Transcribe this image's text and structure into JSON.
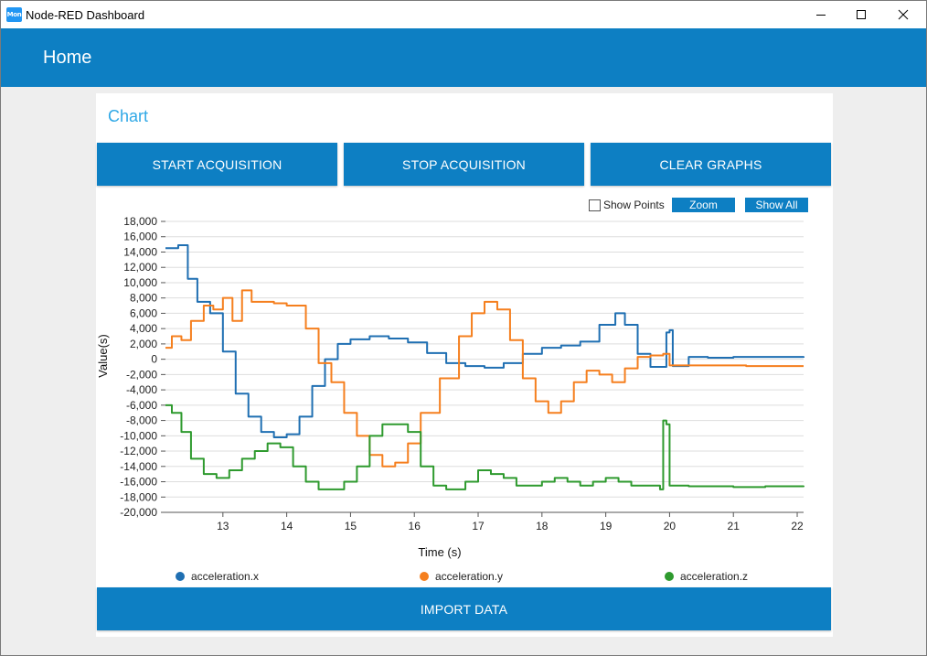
{
  "window": {
    "title": "Node-RED Dashboard",
    "icon_text": "Mon"
  },
  "header": {
    "title": "Home"
  },
  "card": {
    "title": "Chart"
  },
  "buttons": {
    "start": "START ACQUISITION",
    "stop": "STOP ACQUISITION",
    "clear": "CLEAR GRAPHS",
    "import": "IMPORT DATA"
  },
  "toolbar": {
    "show_points": "Show Points",
    "zoom": "Zoom",
    "show_all": "Show All"
  },
  "colors": {
    "accent": "#0d7fc3",
    "title": "#2fa8e6",
    "x": "#1f6fb2",
    "y": "#f57f1e",
    "z": "#2e9a2e"
  },
  "chart_data": {
    "type": "line",
    "xlabel": "Time (s)",
    "ylabel": "Value(s)",
    "xlim": [
      12.1,
      22.1
    ],
    "ylim": [
      -20000,
      18000
    ],
    "x_ticks": [
      13,
      14,
      15,
      16,
      17,
      18,
      19,
      20,
      21,
      22
    ],
    "y_ticks": [
      18000,
      16000,
      14000,
      12000,
      10000,
      8000,
      6000,
      4000,
      2000,
      0,
      -2000,
      -4000,
      -6000,
      -8000,
      -10000,
      -12000,
      -14000,
      -16000,
      -18000,
      -20000
    ],
    "y_tick_labels": [
      "18,000",
      "16,000",
      "14,000",
      "12,000",
      "10,000",
      "8,000",
      "6,000",
      "4,000",
      "2,000",
      "0",
      "-2,000",
      "-4,000",
      "-6,000",
      "-8,000",
      "-10,000",
      "-12,000",
      "-14,000",
      "-16,000",
      "-18,000",
      "-20,000"
    ],
    "grid": true,
    "legend": "bottom",
    "series": [
      {
        "name": "acceleration.x",
        "color": "#1f6fb2",
        "x": [
          12.1,
          12.3,
          12.45,
          12.6,
          12.8,
          13.0,
          13.2,
          13.4,
          13.6,
          13.8,
          14.0,
          14.2,
          14.4,
          14.6,
          14.8,
          15.0,
          15.3,
          15.6,
          15.9,
          16.2,
          16.5,
          16.8,
          17.1,
          17.4,
          17.7,
          18.0,
          18.3,
          18.6,
          18.9,
          19.15,
          19.3,
          19.5,
          19.7,
          19.9,
          19.95,
          20.0,
          20.05,
          20.3,
          20.6,
          21.0,
          21.5,
          22.1
        ],
        "y": [
          14500,
          14900,
          10500,
          7500,
          6000,
          1000,
          -4500,
          -7500,
          -9500,
          -10200,
          -9800,
          -7500,
          -3500,
          0,
          2000,
          2600,
          3000,
          2700,
          2200,
          800,
          -500,
          -900,
          -1100,
          -500,
          700,
          1500,
          1800,
          2300,
          4500,
          6000,
          4500,
          700,
          -1000,
          -1000,
          3500,
          3800,
          -900,
          300,
          200,
          300,
          300,
          200
        ]
      },
      {
        "name": "acceleration.y",
        "color": "#f57f1e",
        "x": [
          12.1,
          12.2,
          12.35,
          12.5,
          12.7,
          12.85,
          13.0,
          13.15,
          13.3,
          13.45,
          13.6,
          13.8,
          14.0,
          14.3,
          14.5,
          14.7,
          14.9,
          15.1,
          15.3,
          15.5,
          15.7,
          15.9,
          16.1,
          16.4,
          16.7,
          16.9,
          17.1,
          17.3,
          17.5,
          17.7,
          17.9,
          18.1,
          18.3,
          18.5,
          18.7,
          18.9,
          19.1,
          19.3,
          19.5,
          19.7,
          19.9,
          20.0,
          20.3,
          20.7,
          21.2,
          22.1
        ],
        "y": [
          1500,
          3000,
          2500,
          5000,
          7000,
          6500,
          8000,
          5000,
          9000,
          7500,
          7500,
          7300,
          7000,
          4000,
          -500,
          -3000,
          -7000,
          -10000,
          -12500,
          -14000,
          -13500,
          -11000,
          -7000,
          -2500,
          3000,
          6000,
          7500,
          6500,
          2500,
          -2500,
          -5500,
          -7000,
          -5500,
          -3000,
          -1500,
          -2000,
          -3000,
          -1200,
          300,
          500,
          700,
          -800,
          -800,
          -800,
          -900,
          -900
        ]
      },
      {
        "name": "acceleration.z",
        "color": "#2e9a2e",
        "x": [
          12.1,
          12.2,
          12.35,
          12.5,
          12.7,
          12.9,
          13.1,
          13.3,
          13.5,
          13.7,
          13.9,
          14.1,
          14.3,
          14.5,
          14.7,
          14.9,
          15.1,
          15.3,
          15.5,
          15.7,
          15.9,
          16.1,
          16.3,
          16.5,
          16.8,
          17.0,
          17.2,
          17.4,
          17.6,
          17.8,
          18.0,
          18.2,
          18.4,
          18.6,
          18.8,
          19.0,
          19.2,
          19.4,
          19.6,
          19.85,
          19.9,
          19.95,
          20.0,
          20.05,
          20.3,
          20.6,
          21.0,
          21.5,
          22.1
        ],
        "y": [
          -6000,
          -7000,
          -9500,
          -13000,
          -15000,
          -15500,
          -14500,
          -13000,
          -12000,
          -11000,
          -11500,
          -14000,
          -16000,
          -17000,
          -17000,
          -16000,
          -14000,
          -10000,
          -8500,
          -8500,
          -9500,
          -14000,
          -16500,
          -17000,
          -16000,
          -14500,
          -15000,
          -15500,
          -16500,
          -16500,
          -16000,
          -15500,
          -16000,
          -16500,
          -16000,
          -15500,
          -16000,
          -16500,
          -16500,
          -17000,
          -8000,
          -8500,
          -16500,
          -16500,
          -16600,
          -16600,
          -16700,
          -16600,
          -16500
        ]
      }
    ]
  }
}
